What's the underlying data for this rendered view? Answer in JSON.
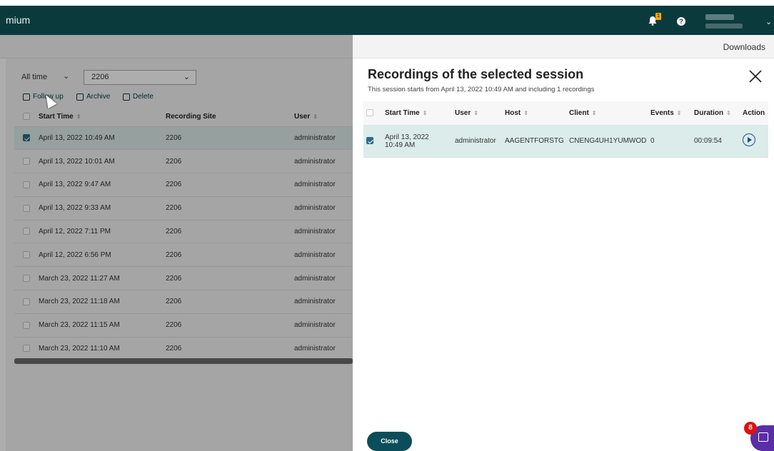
{
  "header": {
    "app_name": "mium",
    "notification_count": "1",
    "help_icon": "?"
  },
  "subbar": {
    "downloads": "Downloads"
  },
  "left": {
    "filter_time": "All time",
    "filter_site": "2206",
    "actions": {
      "follow_up": "Follow up",
      "archive": "Archive",
      "delete": "Delete"
    },
    "columns": [
      "Start Time",
      "Recording Site",
      "User"
    ],
    "rows": [
      {
        "start": "April 13, 2022 10:49 AM",
        "site": "2206",
        "user": "administrator",
        "selected": true
      },
      {
        "start": "April 13, 2022 10:01 AM",
        "site": "2206",
        "user": "administrator",
        "selected": false
      },
      {
        "start": "April 13, 2022 9:47 AM",
        "site": "2206",
        "user": "administrator",
        "selected": false
      },
      {
        "start": "April 13, 2022 9:33 AM",
        "site": "2206",
        "user": "administrator",
        "selected": false
      },
      {
        "start": "April 12, 2022 7:11 PM",
        "site": "2206",
        "user": "administrator",
        "selected": false
      },
      {
        "start": "April 12, 2022 6:56 PM",
        "site": "2206",
        "user": "administrator",
        "selected": false
      },
      {
        "start": "March 23, 2022 11:27 AM",
        "site": "2206",
        "user": "administrator",
        "selected": false
      },
      {
        "start": "March 23, 2022 11:18 AM",
        "site": "2206",
        "user": "administrator",
        "selected": false
      },
      {
        "start": "March 23, 2022 11:15 AM",
        "site": "2206",
        "user": "administrator",
        "selected": false
      },
      {
        "start": "March 23, 2022 11:10 AM",
        "site": "2206",
        "user": "administrator",
        "selected": false
      }
    ]
  },
  "panel": {
    "title": "Recordings of the selected session",
    "subtitle": "This session starts from April 13, 2022 10:49 AM and including 1 recordings",
    "columns": [
      "Start Time",
      "User",
      "Host",
      "Client",
      "Events",
      "Duration",
      "Action"
    ],
    "row": {
      "start_line1": "April 13, 2022",
      "start_line2": "10:49 AM",
      "user": "administrator",
      "host": "AAGENTFORSTG",
      "client": "CNENG4UH1YUMWOD",
      "events": "0",
      "duration": "00:09:54"
    },
    "close_label": "Close"
  },
  "assistant": {
    "badge_count": "8"
  },
  "colors": {
    "header_bg": "#0b3a3d",
    "accent": "#0b4d5a",
    "selected_row": "#dceceb",
    "assistant": "#5a2ea6"
  }
}
